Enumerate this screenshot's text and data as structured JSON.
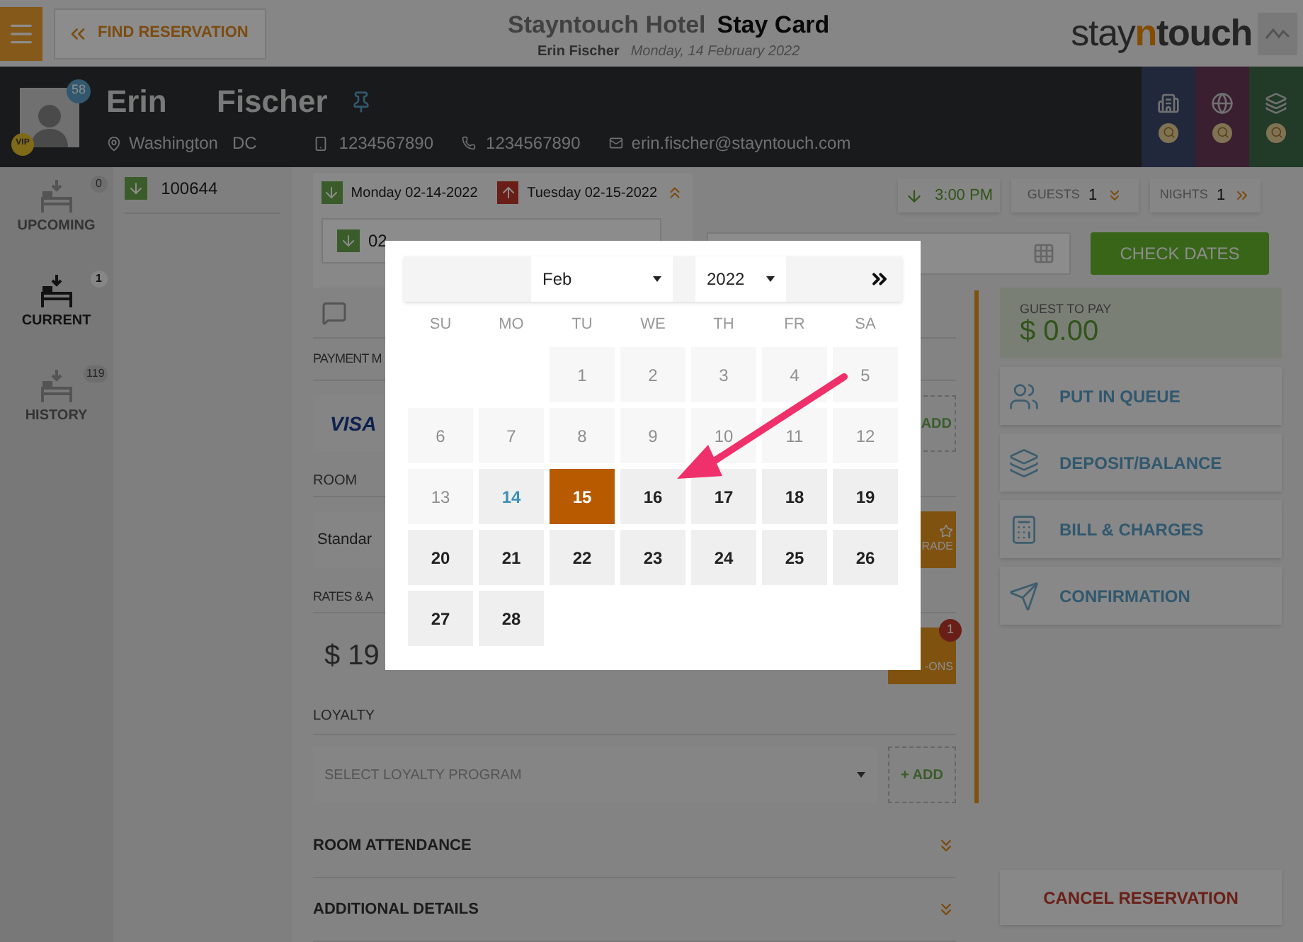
{
  "header": {
    "back_button": "FIND RESERVATION",
    "hotel": "Stayntouch Hotel",
    "title": "Stay Card",
    "guest_name": "Erin Fischer",
    "date": "Monday, 14 February 2022",
    "logo": [
      "stay",
      "n",
      "touch"
    ]
  },
  "guest": {
    "first_name": "Erin",
    "last_name": "Fischer",
    "badge": "58",
    "vip": "VIP",
    "city": "Washington",
    "state": "DC",
    "mobile": "1234567890",
    "phone": "1234567890",
    "email": "erin.fischer@stayntouch.com"
  },
  "nav": [
    {
      "label": "UPCOMING",
      "count": "0",
      "selected": false
    },
    {
      "label": "CURRENT",
      "count": "1",
      "selected": true
    },
    {
      "label": "HISTORY",
      "count": "119",
      "selected": false
    }
  ],
  "reservations": [
    {
      "number": "100644"
    }
  ],
  "dates": {
    "arrival": "Monday 02-14-2022",
    "departure": "Tuesday 02-15-2022",
    "arrival_time": "3:00 PM",
    "guests_label": "GUESTS",
    "guests": "1",
    "nights_label": "NIGHTS",
    "nights": "1",
    "date_field": "02",
    "check_dates": "CHECK DATES"
  },
  "form": {
    "payment_label": "PAYMENT M",
    "card": "VISA",
    "payment_add": "ADD",
    "room_label": "ROOM",
    "room": "Standar",
    "upgrade": "RADE",
    "rates_label": "RATES & A",
    "rate": "$ 19",
    "addons": "-ONS",
    "addons_badge": "1",
    "loyalty_label": "LOYALTY",
    "loyalty_placeholder": "SELECT LOYALTY PROGRAM",
    "loyalty_add": "+ ADD",
    "sections": [
      "ROOM ATTENDANCE",
      "ADDITIONAL DETAILS"
    ]
  },
  "balance": {
    "label": "GUEST TO PAY",
    "amount": "$ 0.00"
  },
  "actions": [
    {
      "label": "PUT IN QUEUE",
      "kind": "queue"
    },
    {
      "label": "DEPOSIT/BALANCE",
      "kind": "deposit"
    },
    {
      "label": "BILL & CHARGES",
      "kind": "bill"
    },
    {
      "label": "CONFIRMATION",
      "kind": "confirm"
    }
  ],
  "cancel": "CANCEL RESERVATION",
  "calendar": {
    "month": "Feb",
    "year": "2022",
    "weekdays": [
      "SU",
      "MO",
      "TU",
      "WE",
      "TH",
      "FR",
      "SA"
    ],
    "days": [
      {
        "day": "1",
        "kind": "disabled",
        "selected": false
      },
      {
        "day": "2",
        "kind": "disabled",
        "selected": false
      },
      {
        "day": "3",
        "kind": "disabled",
        "selected": false
      },
      {
        "day": "4",
        "kind": "disabled",
        "selected": false
      },
      {
        "day": "5",
        "kind": "disabled",
        "selected": false
      },
      {
        "day": "6",
        "kind": "disabled",
        "selected": false
      },
      {
        "day": "7",
        "kind": "disabled",
        "selected": false
      },
      {
        "day": "8",
        "kind": "disabled",
        "selected": false
      },
      {
        "day": "9",
        "kind": "disabled",
        "selected": false
      },
      {
        "day": "10",
        "kind": "disabled",
        "selected": false
      },
      {
        "day": "11",
        "kind": "disabled",
        "selected": false
      },
      {
        "day": "12",
        "kind": "disabled",
        "selected": false
      },
      {
        "day": "13",
        "kind": "disabled",
        "selected": false
      },
      {
        "day": "14",
        "kind": "today",
        "selected": false
      },
      {
        "day": "15",
        "kind": "normal",
        "selected": true
      },
      {
        "day": "16",
        "kind": "normal",
        "selected": false
      },
      {
        "day": "17",
        "kind": "normal",
        "selected": false
      },
      {
        "day": "18",
        "kind": "normal",
        "selected": false
      },
      {
        "day": "19",
        "kind": "normal",
        "selected": false
      },
      {
        "day": "20",
        "kind": "normal",
        "selected": false
      },
      {
        "day": "21",
        "kind": "normal",
        "selected": false
      },
      {
        "day": "22",
        "kind": "normal",
        "selected": false
      },
      {
        "day": "23",
        "kind": "normal",
        "selected": false
      },
      {
        "day": "24",
        "kind": "normal",
        "selected": false
      },
      {
        "day": "25",
        "kind": "normal",
        "selected": false
      },
      {
        "day": "26",
        "kind": "normal",
        "selected": false
      },
      {
        "day": "27",
        "kind": "normal",
        "selected": false
      },
      {
        "day": "28",
        "kind": "normal",
        "selected": false
      }
    ]
  }
}
